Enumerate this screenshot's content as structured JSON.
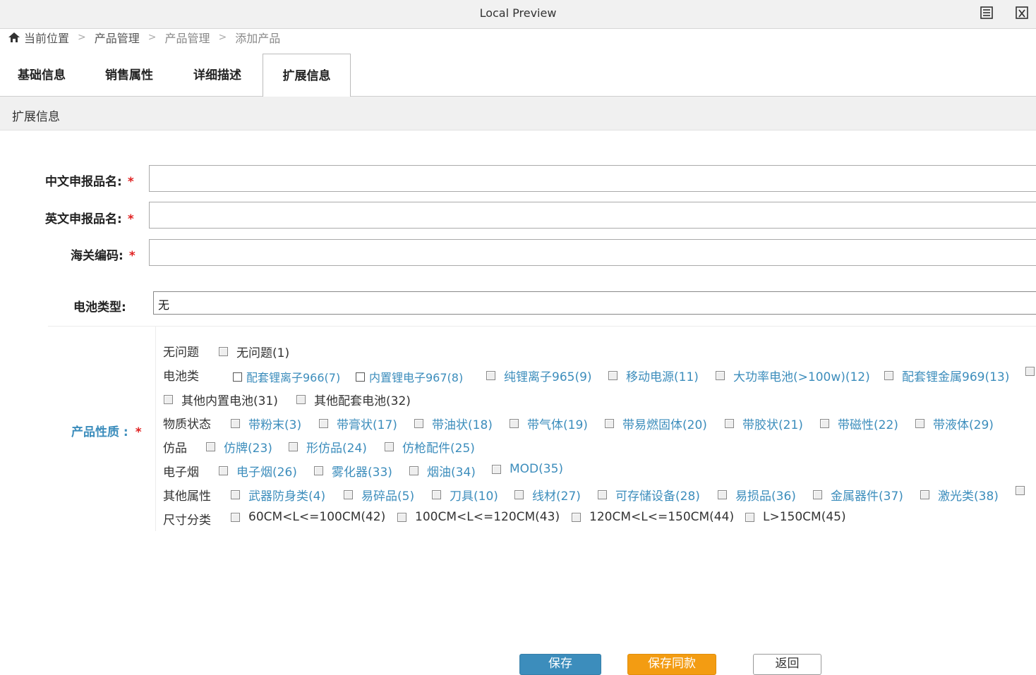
{
  "window": {
    "title": "Local Preview"
  },
  "breadcrumb": {
    "items": [
      "当前位置",
      "产品管理",
      "产品管理",
      "添加产品"
    ]
  },
  "tabs": [
    "基础信息",
    "销售属性",
    "详细描述",
    "扩展信息"
  ],
  "section": {
    "title": "扩展信息"
  },
  "form": {
    "cn_name_label": "中文申报品名:",
    "en_name_label": "英文申报品名:",
    "hs_code_label": "海关编码:",
    "required_mark": "*",
    "battery_label": "电池类型:",
    "battery_value": "无",
    "property_label": "产品性质 :"
  },
  "properties": [
    {
      "category": "无问题",
      "options": [
        "无问题(1)"
      ]
    },
    {
      "category": "电池类",
      "options": [
        "配套锂离子966(7)",
        "内置锂电子967(8)",
        "纯锂离子965(9)",
        "移动电源(11)",
        "大功率电池(>100w)(12)",
        "配套锂金属969(13)",
        "其他内置电池(31)",
        "其他配套电池(32)"
      ]
    },
    {
      "category": "物质状态",
      "options": [
        "带粉末(3)",
        "带膏状(17)",
        "带油状(18)",
        "带气体(19)",
        "带易燃固体(20)",
        "带胶状(21)",
        "带磁性(22)",
        "带液体(29)"
      ]
    },
    {
      "category": "仿品",
      "options": [
        "仿牌(23)",
        "形仿品(24)",
        "仿枪配件(25)"
      ]
    },
    {
      "category": "电子烟",
      "options": [
        "电子烟(26)",
        "雾化器(33)",
        "烟油(34)",
        "MOD(35)"
      ]
    },
    {
      "category": "其他属性",
      "options": [
        "武器防身类(4)",
        "易碎品(5)",
        "刀具(10)",
        "线材(27)",
        "可存储设备(28)",
        "易损品(36)",
        "金属器件(37)",
        "激光类(38)"
      ]
    },
    {
      "category": "尺寸分类",
      "options": [
        "60CM<L<=100CM(42)",
        "100CM<L<=120CM(43)",
        "120CM<L<=150CM(44)",
        "L>150CM(45)"
      ]
    }
  ],
  "buttons": {
    "save": "保存",
    "save_sync": "保存同款",
    "back": "返回"
  },
  "colors": {
    "accent": "#3c8dbc",
    "required": "#e02020",
    "warning": "#f39c12"
  }
}
